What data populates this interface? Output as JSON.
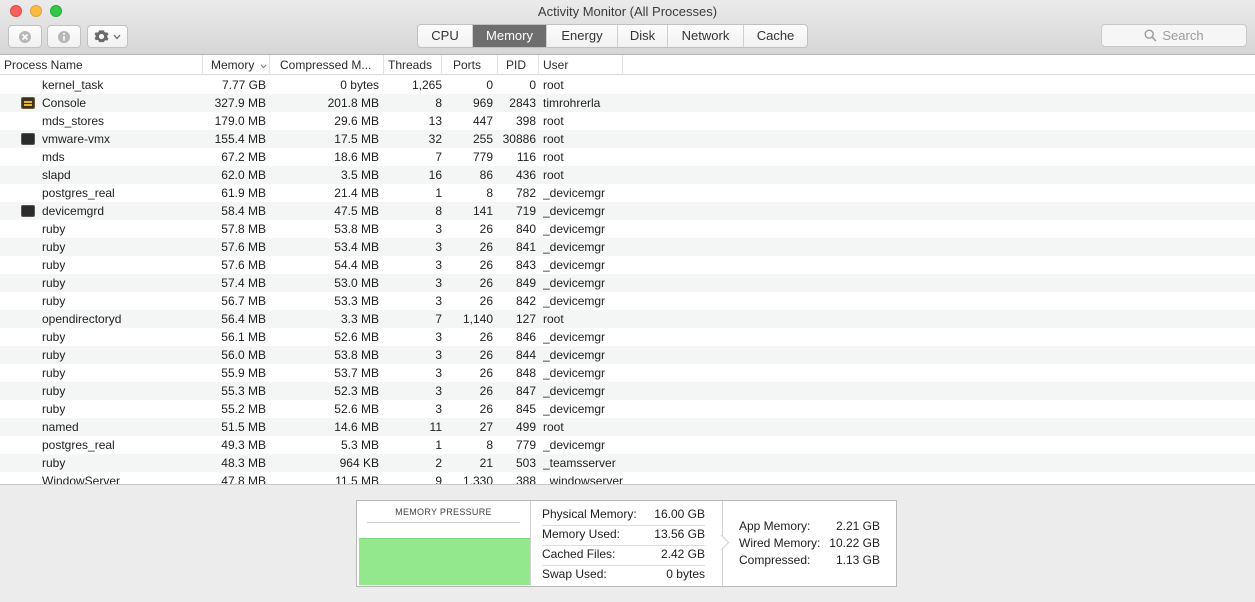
{
  "window": {
    "title": "Activity Monitor (All Processes)"
  },
  "toolbar": {
    "stop_icon": "stop-process-icon",
    "info_icon": "info-icon",
    "gear_icon": "gear-icon",
    "tabs": [
      "CPU",
      "Memory",
      "Energy",
      "Disk",
      "Network",
      "Cache"
    ],
    "active_tab": "Memory",
    "search_placeholder": "Search"
  },
  "table": {
    "columns": [
      "Process Name",
      "Memory",
      "Compressed M...",
      "Threads",
      "Ports",
      "PID",
      "User"
    ],
    "sort_column": "Memory",
    "rows": [
      {
        "name": "kernel_task",
        "icon": "",
        "memory": "7.77 GB",
        "compressed": "0 bytes",
        "threads": "1,265",
        "ports": "0",
        "pid": "0",
        "user": "root"
      },
      {
        "name": "Console",
        "icon": "console",
        "memory": "327.9 MB",
        "compressed": "201.8 MB",
        "threads": "8",
        "ports": "969",
        "pid": "2843",
        "user": "timrohrerla"
      },
      {
        "name": "mds_stores",
        "icon": "",
        "memory": "179.0 MB",
        "compressed": "29.6 MB",
        "threads": "13",
        "ports": "447",
        "pid": "398",
        "user": "root"
      },
      {
        "name": "vmware-vmx",
        "icon": "term",
        "memory": "155.4 MB",
        "compressed": "17.5 MB",
        "threads": "32",
        "ports": "255",
        "pid": "30886",
        "user": "root"
      },
      {
        "name": "mds",
        "icon": "",
        "memory": "67.2 MB",
        "compressed": "18.6 MB",
        "threads": "7",
        "ports": "779",
        "pid": "116",
        "user": "root"
      },
      {
        "name": "slapd",
        "icon": "",
        "memory": "62.0 MB",
        "compressed": "3.5 MB",
        "threads": "16",
        "ports": "86",
        "pid": "436",
        "user": "root"
      },
      {
        "name": "postgres_real",
        "icon": "",
        "memory": "61.9 MB",
        "compressed": "21.4 MB",
        "threads": "1",
        "ports": "8",
        "pid": "782",
        "user": "_devicemgr"
      },
      {
        "name": "devicemgrd",
        "icon": "term",
        "memory": "58.4 MB",
        "compressed": "47.5 MB",
        "threads": "8",
        "ports": "141",
        "pid": "719",
        "user": "_devicemgr"
      },
      {
        "name": "ruby",
        "icon": "",
        "memory": "57.8 MB",
        "compressed": "53.8 MB",
        "threads": "3",
        "ports": "26",
        "pid": "840",
        "user": "_devicemgr"
      },
      {
        "name": "ruby",
        "icon": "",
        "memory": "57.6 MB",
        "compressed": "53.4 MB",
        "threads": "3",
        "ports": "26",
        "pid": "841",
        "user": "_devicemgr"
      },
      {
        "name": "ruby",
        "icon": "",
        "memory": "57.6 MB",
        "compressed": "54.4 MB",
        "threads": "3",
        "ports": "26",
        "pid": "843",
        "user": "_devicemgr"
      },
      {
        "name": "ruby",
        "icon": "",
        "memory": "57.4 MB",
        "compressed": "53.0 MB",
        "threads": "3",
        "ports": "26",
        "pid": "849",
        "user": "_devicemgr"
      },
      {
        "name": "ruby",
        "icon": "",
        "memory": "56.7 MB",
        "compressed": "53.3 MB",
        "threads": "3",
        "ports": "26",
        "pid": "842",
        "user": "_devicemgr"
      },
      {
        "name": "opendirectoryd",
        "icon": "",
        "memory": "56.4 MB",
        "compressed": "3.3 MB",
        "threads": "7",
        "ports": "1,140",
        "pid": "127",
        "user": "root"
      },
      {
        "name": "ruby",
        "icon": "",
        "memory": "56.1 MB",
        "compressed": "52.6 MB",
        "threads": "3",
        "ports": "26",
        "pid": "846",
        "user": "_devicemgr"
      },
      {
        "name": "ruby",
        "icon": "",
        "memory": "56.0 MB",
        "compressed": "53.8 MB",
        "threads": "3",
        "ports": "26",
        "pid": "844",
        "user": "_devicemgr"
      },
      {
        "name": "ruby",
        "icon": "",
        "memory": "55.9 MB",
        "compressed": "53.7 MB",
        "threads": "3",
        "ports": "26",
        "pid": "848",
        "user": "_devicemgr"
      },
      {
        "name": "ruby",
        "icon": "",
        "memory": "55.3 MB",
        "compressed": "52.3 MB",
        "threads": "3",
        "ports": "26",
        "pid": "847",
        "user": "_devicemgr"
      },
      {
        "name": "ruby",
        "icon": "",
        "memory": "55.2 MB",
        "compressed": "52.6 MB",
        "threads": "3",
        "ports": "26",
        "pid": "845",
        "user": "_devicemgr"
      },
      {
        "name": "named",
        "icon": "",
        "memory": "51.5 MB",
        "compressed": "14.6 MB",
        "threads": "11",
        "ports": "27",
        "pid": "499",
        "user": "root"
      },
      {
        "name": "postgres_real",
        "icon": "",
        "memory": "49.3 MB",
        "compressed": "5.3 MB",
        "threads": "1",
        "ports": "8",
        "pid": "779",
        "user": "_devicemgr"
      },
      {
        "name": "ruby",
        "icon": "",
        "memory": "48.3 MB",
        "compressed": "964 KB",
        "threads": "2",
        "ports": "21",
        "pid": "503",
        "user": "_teamsserver"
      },
      {
        "name": "WindowServer",
        "icon": "",
        "memory": "47.8 MB",
        "compressed": "11.5 MB",
        "threads": "9",
        "ports": "1,330",
        "pid": "388",
        "user": "_windowserver"
      }
    ]
  },
  "memory_panel": {
    "pressure_title": "MEMORY PRESSURE",
    "pressure_color": "#93e88e",
    "stats_left": [
      {
        "label": "Physical Memory:",
        "value": "16.00 GB"
      },
      {
        "label": "Memory Used:",
        "value": "13.56 GB"
      },
      {
        "label": "Cached Files:",
        "value": "2.42 GB"
      },
      {
        "label": "Swap Used:",
        "value": "0 bytes"
      }
    ],
    "stats_right": [
      {
        "label": "App Memory:",
        "value": "2.21 GB"
      },
      {
        "label": "Wired Memory:",
        "value": "10.22 GB"
      },
      {
        "label": "Compressed:",
        "value": "1.13 GB"
      }
    ]
  }
}
